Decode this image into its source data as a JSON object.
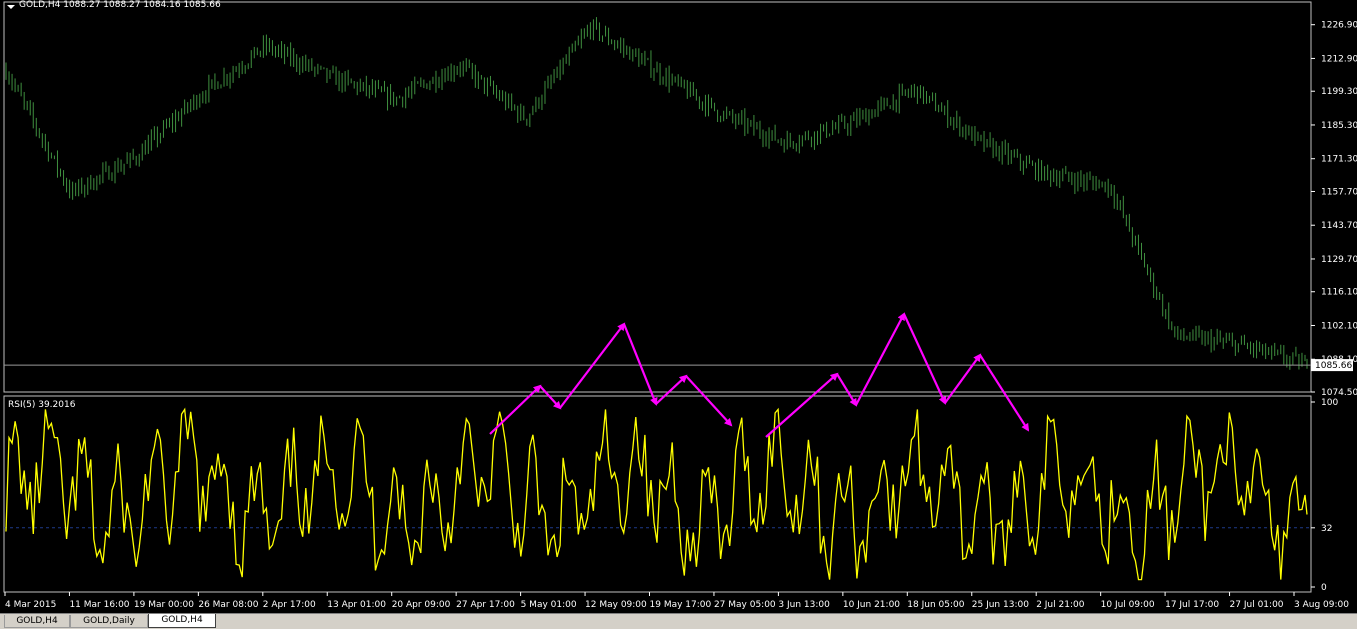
{
  "window": {
    "header": "GOLD,H4  1088.27 1088.27 1084.16 1085.66"
  },
  "price_pane": {
    "y_ticks": [
      "1226.90",
      "1212.90",
      "1199.30",
      "1185.30",
      "1171.30",
      "1157.70",
      "1143.70",
      "1129.70",
      "1116.10",
      "1102.10",
      "1088.10",
      "1074.50"
    ],
    "current_price_label": "1085.66"
  },
  "rsi_pane": {
    "label": "RSI(5) 39.2016",
    "y_ticks": [
      "100",
      "32",
      "0"
    ]
  },
  "x_axis": {
    "labels": [
      "4 Mar 2015",
      "11 Mar 16:00",
      "19 Mar 00:00",
      "26 Mar 08:00",
      "2 Apr 17:00",
      "13 Apr 01:00",
      "20 Apr 09:00",
      "27 Apr 17:00",
      "5 May 01:00",
      "12 May 09:00",
      "19 May 17:00",
      "27 May 05:00",
      "3 Jun 13:00",
      "10 Jun 21:00",
      "18 Jun 05:00",
      "25 Jun 13:00",
      "2 Jul 21:00",
      "10 Jul 09:00",
      "17 Jul 17:00",
      "27 Jul 01:00",
      "3 Aug 09:00"
    ]
  },
  "tabs": [
    {
      "label": "GOLD,H4",
      "active": false
    },
    {
      "label": "GOLD,Daily",
      "active": false
    },
    {
      "label": "GOLD,H4",
      "active": true
    }
  ],
  "colors": {
    "background": "#000000",
    "candles": "#3f8f3f",
    "rsi_line": "#ffff00",
    "rsi_level": "#1e3a8a",
    "annotation": "#ff00ff",
    "price_line": "#9a9a9a"
  },
  "chart_data": [
    {
      "type": "candlestick",
      "symbol": "GOLD",
      "timeframe": "H4",
      "ylim": [
        1074.5,
        1233
      ],
      "last": {
        "open": 1088.27,
        "high": 1088.27,
        "low": 1084.16,
        "close": 1085.66
      },
      "price_path": [
        [
          "4 Mar 2015",
          1208
        ],
        [
          "11 Mar 16:00",
          1157
        ],
        [
          "19 Mar 00:00",
          1172
        ],
        [
          "26 Mar 08:00",
          1198
        ],
        [
          "2 Apr 17:00",
          1218
        ],
        [
          "13 Apr 01:00",
          1205
        ],
        [
          "20 Apr 09:00",
          1196
        ],
        [
          "27 Apr 17:00",
          1210
        ],
        [
          "5 May 01:00",
          1188
        ],
        [
          "12 May 09:00",
          1226
        ],
        [
          "19 May 17:00",
          1208
        ],
        [
          "27 May 05:00",
          1190
        ],
        [
          "3 Jun 13:00",
          1178
        ],
        [
          "10 Jun 21:00",
          1186
        ],
        [
          "18 Jun 05:00",
          1200
        ],
        [
          "25 Jun 13:00",
          1178
        ],
        [
          "2 Jul 21:00",
          1165
        ],
        [
          "10 Jul 09:00",
          1160
        ],
        [
          "17 Jul 17:00",
          1098
        ],
        [
          "27 Jul 01:00",
          1094
        ],
        [
          "3 Aug 09:00",
          1086
        ]
      ]
    },
    {
      "type": "line",
      "name": "RSI(5)",
      "ylim": [
        0,
        100
      ],
      "level": 32,
      "last_value": 39.2016
    }
  ]
}
